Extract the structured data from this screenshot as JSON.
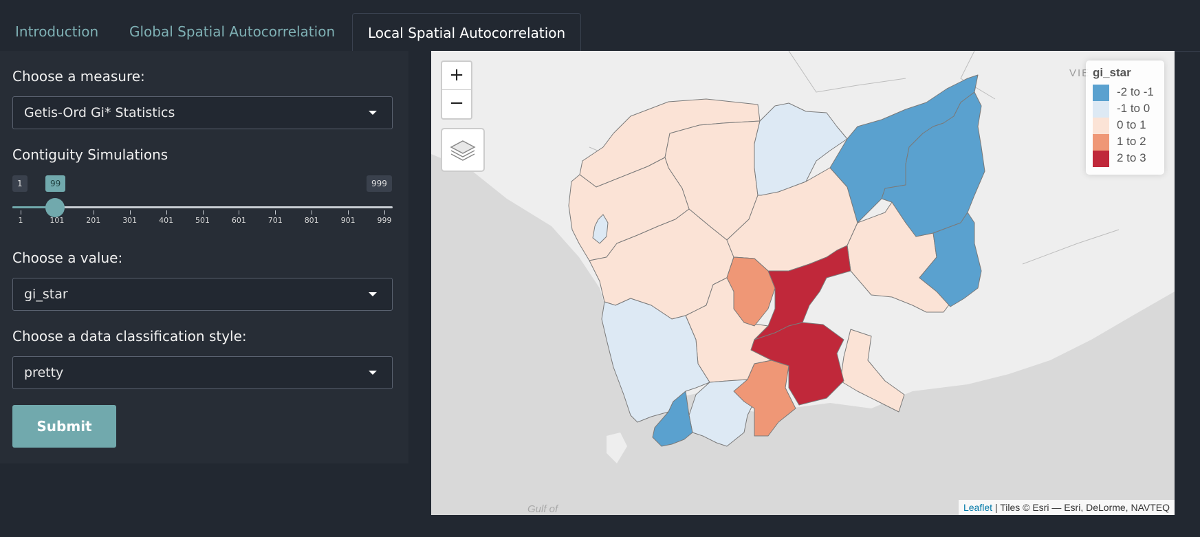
{
  "tabs": [
    {
      "label": "Introduction"
    },
    {
      "label": "Global Spatial Autocorrelation"
    },
    {
      "label": "Local Spatial Autocorrelation"
    }
  ],
  "sidebar": {
    "measure_label": "Choose a measure:",
    "measure_value": "Getis-Ord Gi* Statistics",
    "simulations_label": "Contiguity Simulations",
    "slider": {
      "min": "1",
      "value": "99",
      "max": "999",
      "ticks": [
        "1",
        "101",
        "201",
        "301",
        "401",
        "501",
        "601",
        "701",
        "801",
        "901",
        "999"
      ]
    },
    "value_label": "Choose a value:",
    "value_value": "gi_star",
    "classification_label": "Choose a data classification style:",
    "classification_value": "pretty",
    "submit_label": "Submit"
  },
  "map": {
    "zoom_in": "+",
    "zoom_out": "−",
    "legend": {
      "title": "gi_star",
      "items": [
        {
          "label": "-2 to -1",
          "color": "#5aa1cf"
        },
        {
          "label": "-1 to 0",
          "color": "#dde9f4"
        },
        {
          "label": "0 to 1",
          "color": "#fbe3d6"
        },
        {
          "label": "1 to 2",
          "color": "#ef9776"
        },
        {
          "label": "2 to 3",
          "color": "#c0283a"
        }
      ]
    },
    "attribution_link": "Leaflet",
    "attribution_text": " | Tiles © Esri — Esri, DeLorme, NAVTEQ",
    "basemap_labels": {
      "vie": "VIE",
      "gulf": "Gulf of"
    }
  },
  "colors": {
    "background": "#222831",
    "sidebar": "#272d36",
    "accent": "#71a9ad",
    "tab_inactive": "#7fb1b5"
  }
}
